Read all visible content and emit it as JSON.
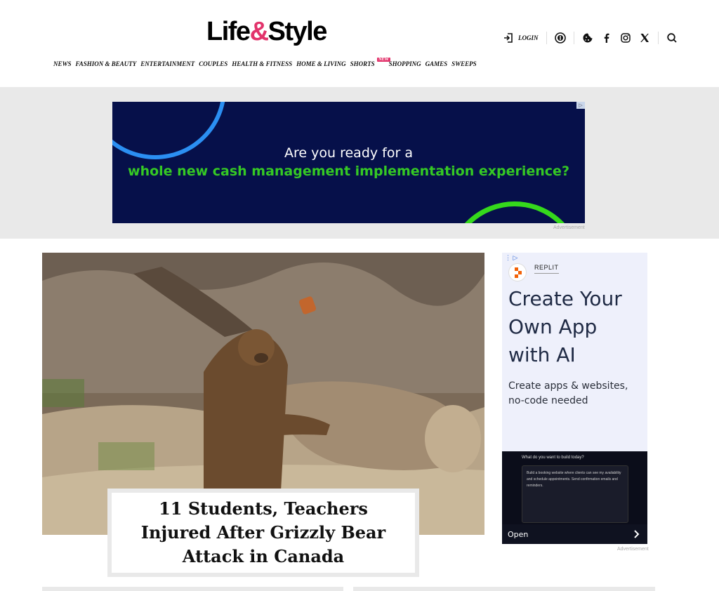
{
  "brand": {
    "logo_left": "Life",
    "logo_amp": "&",
    "logo_right": "Style",
    "accent_color": "#e2336b"
  },
  "nav": {
    "items": [
      "NEWS",
      "FASHION & BEAUTY",
      "ENTERTAINMENT",
      "COUPLES",
      "HEALTH & FITNESS",
      "HOME & LIVING",
      "SHORTS",
      "SHOPPING",
      "GAMES",
      "SWEEPS"
    ],
    "new_badge": "NEW"
  },
  "header_tools": {
    "login_label": "LOGIN",
    "icons": [
      "login-icon",
      "info-icon",
      "cookie-icon",
      "facebook-icon",
      "instagram-icon",
      "x-icon",
      "search-icon"
    ]
  },
  "banner_ad": {
    "line1": "Are you ready for a",
    "line2": "whole new cash management implementation experience?",
    "label": "Advertisement"
  },
  "hero": {
    "headline": "11 Students, Teachers Injured After Grizzly Bear Attack in Canada"
  },
  "side_ad": {
    "brand": "REPLIT",
    "headline": "Create Your Own App with AI",
    "subtext": "Create apps & websites, no-code needed",
    "prompt_question": "What do you want to build today?",
    "prompt_text": "Build a booking website where clients can see my availability and schedule appointments. Send confirmation emails and reminders.",
    "cta": "Open",
    "label": "Advertisement"
  }
}
